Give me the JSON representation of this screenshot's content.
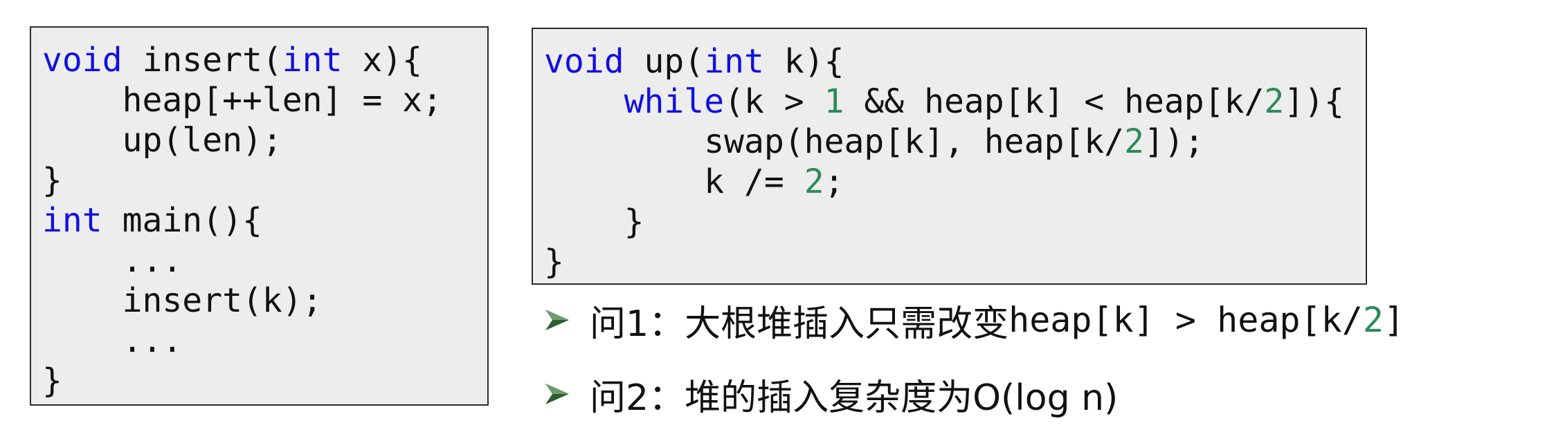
{
  "left_code": {
    "lines": [
      [
        {
          "t": "void",
          "c": "kw"
        },
        {
          "t": " insert("
        },
        {
          "t": "int",
          "c": "kw"
        },
        {
          "t": " x){"
        }
      ],
      [
        {
          "t": "    heap[++len] = x;"
        }
      ],
      [
        {
          "t": "    up(len);"
        }
      ],
      [
        {
          "t": "}"
        }
      ],
      [
        {
          "t": "int",
          "c": "kw"
        },
        {
          "t": " main(){"
        }
      ],
      [
        {
          "t": "    ..."
        }
      ],
      [
        {
          "t": "    insert(k);"
        }
      ],
      [
        {
          "t": "    ..."
        }
      ],
      [
        {
          "t": "}"
        }
      ]
    ]
  },
  "right_code": {
    "lines": [
      [
        {
          "t": "void",
          "c": "kw"
        },
        {
          "t": " up("
        },
        {
          "t": "int",
          "c": "kw"
        },
        {
          "t": " k){"
        }
      ],
      [
        {
          "t": "    "
        },
        {
          "t": "while",
          "c": "kw"
        },
        {
          "t": "(k > "
        },
        {
          "t": "1",
          "c": "num"
        },
        {
          "t": " && heap[k] < heap[k/"
        },
        {
          "t": "2",
          "c": "num"
        },
        {
          "t": "]){"
        }
      ],
      [
        {
          "t": "        swap(heap[k], heap[k/"
        },
        {
          "t": "2",
          "c": "num"
        },
        {
          "t": "]);"
        }
      ],
      [
        {
          "t": "        k /= "
        },
        {
          "t": "2",
          "c": "num"
        },
        {
          "t": ";"
        }
      ],
      [
        {
          "t": "    }"
        }
      ],
      [
        {
          "t": "}"
        }
      ]
    ]
  },
  "bullets": [
    {
      "text": "问1：大根堆插入只需改变",
      "code": [
        {
          "t": "heap[k] > heap[k/"
        },
        {
          "t": "2",
          "c": "num"
        },
        {
          "t": "]"
        }
      ]
    },
    {
      "text": "问2：堆的插入复杂度为O(log n)",
      "code": []
    }
  ],
  "colors": {
    "keyword": "#1010e0",
    "number": "#2e8a5a",
    "code_background": "#ededed",
    "bullet_arrow": "#2e5e2e"
  },
  "icons": {
    "bullet": "arrow-bullet-icon"
  }
}
